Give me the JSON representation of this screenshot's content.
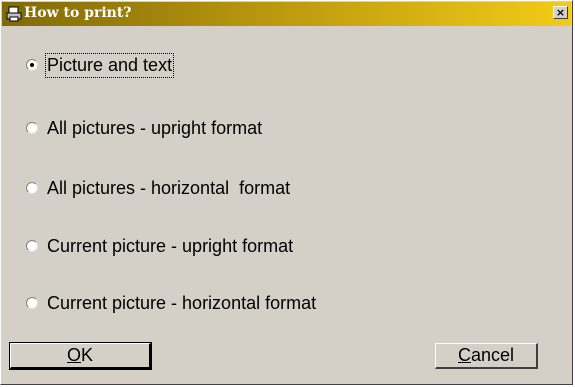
{
  "window": {
    "title": "How to print?",
    "close_glyph": "×",
    "title_icon": "printer-icon"
  },
  "options": [
    {
      "label": "Picture and text",
      "checked": true
    },
    {
      "label": "All pictures - upright format",
      "checked": false
    },
    {
      "label": "All pictures - horizontal  format",
      "checked": false
    },
    {
      "label": "Current picture - upright format",
      "checked": false
    },
    {
      "label": "Current picture - horizontal format",
      "checked": false
    }
  ],
  "buttons": {
    "ok": {
      "accel": "O",
      "rest": "K"
    },
    "cancel": {
      "accel": "C",
      "rest": "ancel"
    }
  },
  "colors": {
    "face": "#d4d0c8",
    "title_dark": "#806a08",
    "title_light": "#f3cb18"
  }
}
